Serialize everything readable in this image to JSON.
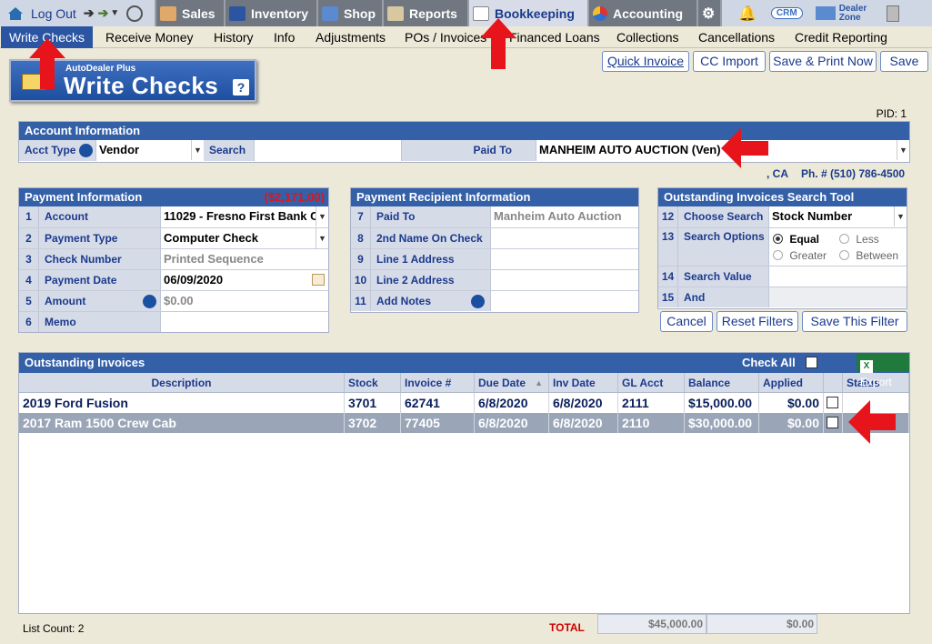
{
  "topnav": {
    "logout": "Log Out",
    "sales": "Sales",
    "inventory": "Inventory",
    "shop": "Shop",
    "reports": "Reports",
    "bookkeeping": "Bookkeeping",
    "accounting": "Accounting",
    "crm": "CRM",
    "dealer_zone_1": "Dealer",
    "dealer_zone_2": "Zone"
  },
  "subnav": [
    "Write Checks",
    "Receive Money",
    "History",
    "Info",
    "Adjustments",
    "POs / Invoices",
    "Financed Loans",
    "Collections",
    "Cancellations",
    "Credit Reporting"
  ],
  "title_badge": {
    "brand": "AutoDealer Plus",
    "title": "Write Checks",
    "help": "?"
  },
  "actions": {
    "quick_invoice": "Quick Invoice",
    "cc_import": "CC Import",
    "save_print": "Save & Print Now",
    "save": "Save"
  },
  "pid": "PID: 1",
  "account": {
    "header": "Account Information",
    "acct_type_label": "Acct Type",
    "acct_type_value": "Vendor",
    "search_label": "Search",
    "search_value": "",
    "paid_to_label": "Paid To",
    "paid_to_value": "MANHEIM AUTO AUCTION (Ven)",
    "city_state": ", CA",
    "phone": "Ph. # (510) 786-4500"
  },
  "payment": {
    "header": "Payment Information",
    "amount_header": "($2,171.00)",
    "rows": [
      {
        "num": "1",
        "label": "Account",
        "value": "11029 - Fresno First Bank Ch"
      },
      {
        "num": "2",
        "label": "Payment Type",
        "value": "Computer Check"
      },
      {
        "num": "3",
        "label": "Check Number",
        "value": "Printed Sequence"
      },
      {
        "num": "4",
        "label": "Payment Date",
        "value": "06/09/2020"
      },
      {
        "num": "5",
        "label": "Amount",
        "value": "$0.00"
      },
      {
        "num": "6",
        "label": "Memo",
        "value": ""
      }
    ]
  },
  "recipient": {
    "header": "Payment Recipient Information",
    "rows": [
      {
        "num": "7",
        "label": "Paid To",
        "value": "Manheim Auto Auction"
      },
      {
        "num": "8",
        "label": "2nd Name On Check",
        "value": ""
      },
      {
        "num": "9",
        "label": "Line 1 Address",
        "value": ""
      },
      {
        "num": "10",
        "label": "Line 2 Address",
        "value": ""
      },
      {
        "num": "11",
        "label": "Add Notes",
        "value": ""
      }
    ]
  },
  "search_tool": {
    "header": "Outstanding Invoices Search Tool",
    "rows": [
      {
        "num": "12",
        "label": "Choose Search",
        "value": "Stock Number"
      },
      {
        "num": "13",
        "label": "Search Options"
      },
      {
        "num": "14",
        "label": "Search Value",
        "value": ""
      },
      {
        "num": "15",
        "label": "And",
        "value": ""
      }
    ],
    "options": [
      "Equal",
      "Less",
      "Greater",
      "Between"
    ],
    "buttons": {
      "cancel": "Cancel",
      "reset": "Reset Filters",
      "save_filter": "Save This Filter"
    }
  },
  "invoices": {
    "header": "Outstanding Invoices",
    "check_all": "Check All",
    "export": "Export",
    "columns": [
      "Description",
      "Stock",
      "Invoice #",
      "Due Date",
      "Inv Date",
      "GL Acct",
      "Balance",
      "Applied",
      "",
      "Status"
    ],
    "rows": [
      {
        "description": "2019 Ford Fusion",
        "stock": "3701",
        "invoice": "62741",
        "due": "6/8/2020",
        "inv": "6/8/2020",
        "gl": "2111",
        "balance": "$15,000.00",
        "applied": "$0.00"
      },
      {
        "description": "2017 Ram 1500 Crew Cab",
        "stock": "3702",
        "invoice": "77405",
        "due": "6/8/2020",
        "inv": "6/8/2020",
        "gl": "2110",
        "balance": "$30,000.00",
        "applied": "$0.00"
      }
    ]
  },
  "footer": {
    "list_count_label": "List Count:",
    "list_count": "2",
    "total_label": "TOTAL",
    "total_balance": "$45,000.00",
    "total_applied": "$0.00"
  },
  "colors": {
    "header_blue": "#3460a8",
    "active_tab": "#2b55a3",
    "arrow_red": "#e8141b",
    "negative_red": "#e0141b"
  }
}
